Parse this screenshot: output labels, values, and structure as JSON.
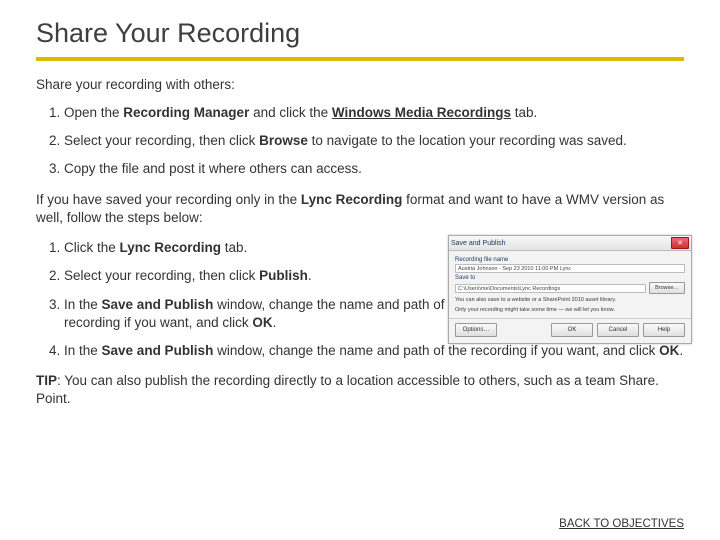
{
  "title": "Share Your Recording",
  "intro": "Share your recording with others:",
  "list1": {
    "i1_a": "Open the ",
    "i1_b": "Recording Manager",
    "i1_c": " and click the ",
    "i1_d": "Windows Media Recordings",
    "i1_e": " tab.",
    "i2_a": "Select your recording, then click ",
    "i2_b": "Browse",
    "i2_c": " to navigate to the location your recording was saved.",
    "i3": "Copy the file and post it where others can access."
  },
  "mid_a": "If you have saved your recording only in the ",
  "mid_b": "Lync Recording",
  "mid_c": " format and want to have a WMV version as well, follow the steps below:",
  "list2": {
    "i1_a": "Click the ",
    "i1_b": "Lync Recording",
    "i1_c": " tab.",
    "i2_a": "Select your recording, then click ",
    "i2_b": "Publish",
    "i2_c": ".",
    "i3_a": "In the ",
    "i3_b": "Save and Publish",
    "i3_c": " window, change the name and path of the recording if you want, and click ",
    "i3_d": "OK",
    "i3_e": ".",
    "i4_a": "In the ",
    "i4_b": "Save and Publish",
    "i4_c": " window, change the name and path of the recording if you want, and click ",
    "i4_d": "OK",
    "i4_e": "."
  },
  "tip_a": "TIP",
  "tip_b": ": You can also publish the recording directly to a location accessible to others, such as a team Share. Point.",
  "back_link": "BACK TO OBJECTIVES",
  "dialog": {
    "title": "Save and Publish",
    "lbl_name": "Recording file name",
    "val_name": "Austria Johnson - Sep 23 2010 11:00 PM Lync",
    "lbl_saveto": "Save to",
    "val_saveto": "C:\\Users\\me\\Documents\\Lync Recordings",
    "browse": "Browse…",
    "note1": "You can also save to a website or a SharePoint 2010 asset library.",
    "note2": "Only your recording might take some time — we will let you know.",
    "btn_options": "Options…",
    "btn_ok": "OK",
    "btn_cancel": "Cancel",
    "btn_help": "Help"
  }
}
